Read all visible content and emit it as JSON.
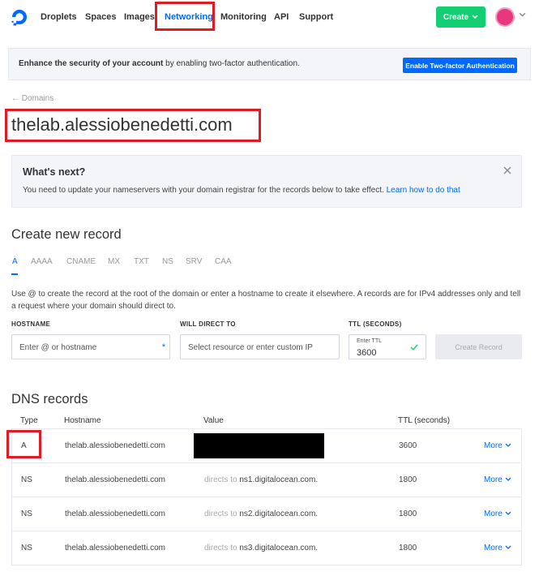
{
  "nav": {
    "items": [
      "Droplets",
      "Spaces",
      "Images",
      "Networking",
      "Monitoring",
      "API",
      "Support"
    ],
    "active": "Networking",
    "create_label": "Create"
  },
  "banner": {
    "bold_text": "Enhance the security of your account",
    "text": " by enabling two-factor authentication.",
    "button_label": "Enable Two-factor Authentication"
  },
  "breadcrumb": "Domains",
  "page_title": "thelab.alessiobenedetti.com",
  "whats_next": {
    "title": "What's next?",
    "text": "You need to update your nameservers with your domain registrar for the records below to take effect. ",
    "link": "Learn how to do that"
  },
  "create_record": {
    "title": "Create new record",
    "tabs": [
      "A",
      "AAAA",
      "CNAME",
      "MX",
      "TXT",
      "NS",
      "SRV",
      "CAA"
    ],
    "active_tab": "A",
    "help": "Use @ to create the record at the root of the domain or enter a hostname to create it elsewhere. A records are for IPv4 addresses only and tell a request where your domain should direct to.",
    "hostname_label": "HOSTNAME",
    "hostname_placeholder": "Enter @ or hostname",
    "direct_label": "WILL DIRECT TO",
    "direct_placeholder": "Select resource or enter custom IP",
    "ttl_label": "TTL (SECONDS)",
    "ttl_small": "Enter TTL",
    "ttl_value": "3600",
    "button_label": "Create Record"
  },
  "dns": {
    "title": "DNS records",
    "headers": [
      "Type",
      "Hostname",
      "Value",
      "TTL (seconds)"
    ],
    "rows": [
      {
        "type": "A",
        "hostname": "thelab.alessiobenedetti.com",
        "value_prefix": "",
        "value": "",
        "ttl": "3600",
        "more": "More"
      },
      {
        "type": "NS",
        "hostname": "thelab.alessiobenedetti.com",
        "value_prefix": "directs to ",
        "value": "ns1.digitalocean.com.",
        "ttl": "1800",
        "more": "More"
      },
      {
        "type": "NS",
        "hostname": "thelab.alessiobenedetti.com",
        "value_prefix": "directs to ",
        "value": "ns2.digitalocean.com.",
        "ttl": "1800",
        "more": "More"
      },
      {
        "type": "NS",
        "hostname": "thelab.alessiobenedetti.com",
        "value_prefix": "directs to ",
        "value": "ns3.digitalocean.com.",
        "ttl": "1800",
        "more": "More"
      }
    ]
  },
  "colors": {
    "accent": "#0069ff",
    "create": "#15cd72",
    "highlight": "#e01b24"
  }
}
